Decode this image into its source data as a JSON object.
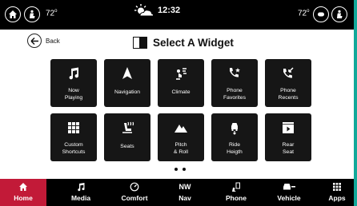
{
  "status": {
    "left_temp": "72",
    "right_temp": "72",
    "degree_mark": "o",
    "time": "12:32"
  },
  "header": {
    "back_label": "Back",
    "title": "Select A Widget"
  },
  "tiles": [
    {
      "label": "Now Playing",
      "icon": "music-note-icon"
    },
    {
      "label": "Navigation",
      "icon": "navigation-arrow-icon"
    },
    {
      "label": "Climate",
      "icon": "climate-fan-icon"
    },
    {
      "label": "Phone Favorites",
      "icon": "phone-star-icon"
    },
    {
      "label": "Phone Recents",
      "icon": "phone-recent-icon"
    },
    {
      "label": "Custom Shortcuts",
      "icon": "grid-icon"
    },
    {
      "label": "Seats",
      "icon": "heated-seat-icon"
    },
    {
      "label": "Pitch & Roll",
      "icon": "mountain-icon"
    },
    {
      "label": "Ride Heigth",
      "icon": "ride-height-icon"
    },
    {
      "label": "Rear Seat",
      "icon": "rear-seat-screen-icon"
    }
  ],
  "pager": {
    "pages": 2,
    "current": 1
  },
  "nav": [
    {
      "label": "Home",
      "icon": "home-icon",
      "active": true
    },
    {
      "label": "Media",
      "icon": "music-note-icon"
    },
    {
      "label": "Comfort",
      "icon": "comfort-dial-icon"
    },
    {
      "label": "Nav",
      "icon": "compass-nw-icon",
      "top_text": "NW"
    },
    {
      "label": "Phone",
      "icon": "phone-keypad-icon"
    },
    {
      "label": "Vehicle",
      "icon": "vehicle-icon"
    },
    {
      "label": "Apps",
      "icon": "apps-grid-icon"
    }
  ],
  "colors": {
    "background": "#ffffff",
    "bars": "#000000",
    "tile": "#161616",
    "active_nav": "#c21a38",
    "bezel": "#11a99a"
  }
}
